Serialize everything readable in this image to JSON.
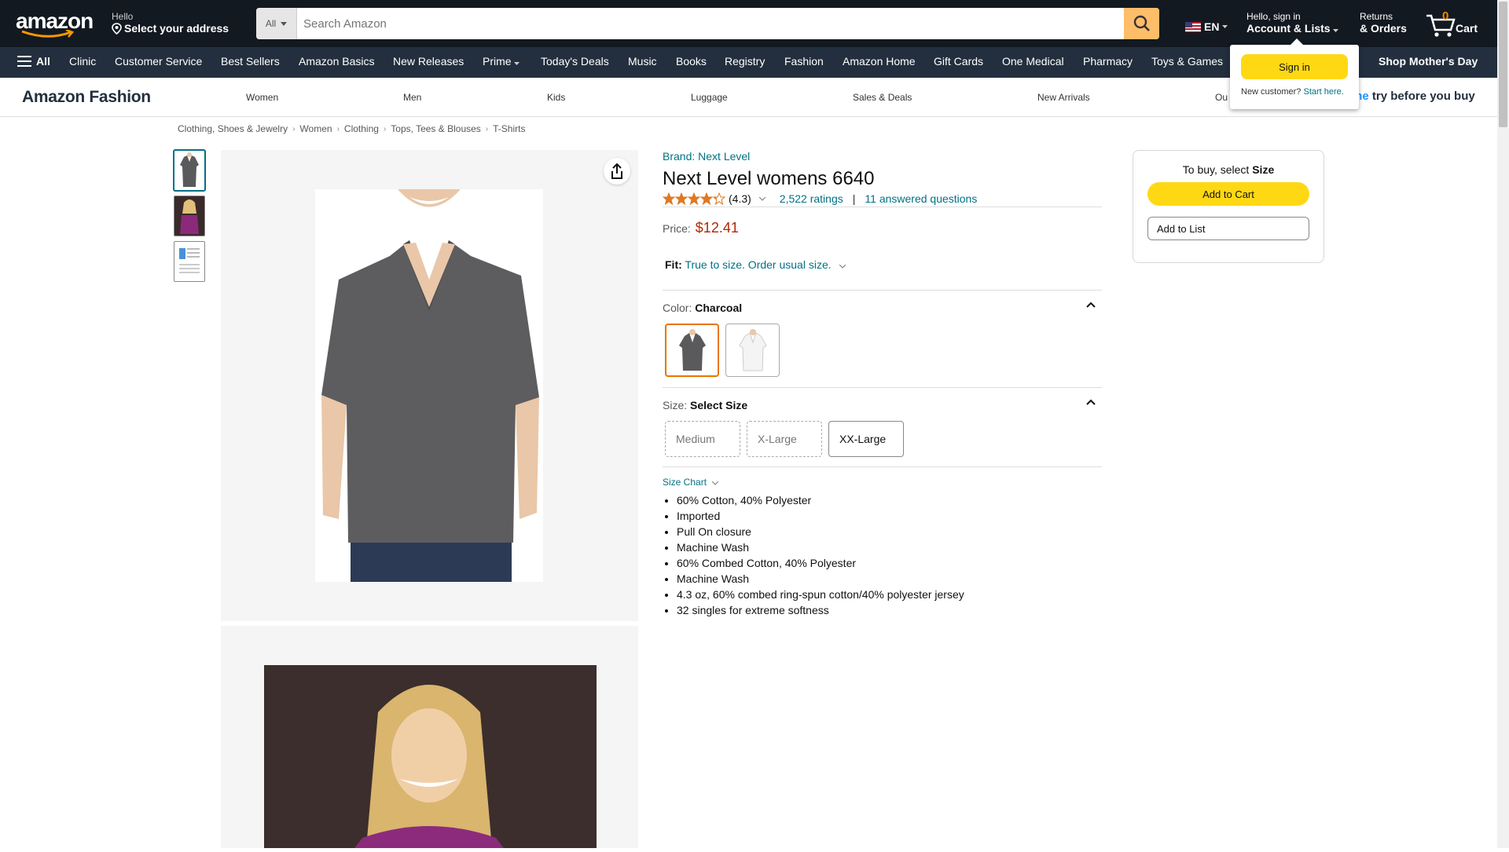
{
  "header": {
    "logo_text": "amazon",
    "address_line1": "Hello",
    "address_line2": "Select your address",
    "search_dept": "All",
    "search_placeholder": "Search Amazon",
    "language": "EN",
    "account_line1": "Hello, sign in",
    "account_line2": "Account & Lists",
    "returns_line1": "Returns",
    "returns_line2": "& Orders",
    "cart_count": "0",
    "cart_label": "Cart"
  },
  "subnav": {
    "all_label": "All",
    "items": [
      "Clinic",
      "Customer Service",
      "Best Sellers",
      "Amazon Basics",
      "New Releases",
      "Prime",
      "Today's Deals",
      "Music",
      "Books",
      "Registry",
      "Fashion",
      "Amazon Home",
      "Gift Cards",
      "One Medical",
      "Pharmacy",
      "Toys & Games"
    ],
    "promo": "Shop Mother's Day"
  },
  "fashion_nav": {
    "brand": "Amazon Fashion",
    "items": [
      "Women",
      "Men",
      "Kids",
      "Luggage",
      "Sales & Deals",
      "New Arrivals",
      "Ou"
    ],
    "try_prefix": "me",
    "try_text": "try before you buy"
  },
  "signin_popover": {
    "button": "Sign in",
    "new_customer": "New customer?",
    "start_here": "Start here."
  },
  "breadcrumb": [
    "Clothing, Shoes & Jewelry",
    "Women",
    "Clothing",
    "Tops, Tees & Blouses",
    "T-Shirts"
  ],
  "product": {
    "brand": "Brand: Next Level",
    "title": "Next Level womens 6640",
    "rating_value": "(4.3)",
    "rating_stars": 4.3,
    "ratings_count": "2,522 ratings",
    "separator": "|",
    "questions": "11 answered questions",
    "price_label": "Price:",
    "price": "$12.41",
    "fit_label": "Fit:",
    "fit_value": "True to size. Order usual size.",
    "color_label": "Color:",
    "color_value": "Charcoal",
    "size_label": "Size:",
    "size_value": "Select Size",
    "sizes": [
      "Medium",
      "X-Large",
      "XX-Large"
    ],
    "size_chart": "Size Chart",
    "bullets": [
      "60% Cotton, 40% Polyester",
      "Imported",
      "Pull On closure",
      "Machine Wash",
      "60% Combed Cotton, 40% Polyester",
      "Machine Wash",
      "4.3 oz, 60% combed ring-spun cotton/40% polyester jersey",
      "32 singles for extreme softness"
    ]
  },
  "buybox": {
    "prompt_prefix": "To buy, select",
    "prompt_bold": "Size",
    "add_to_cart": "Add to Cart",
    "add_to_list": "Add to List"
  },
  "colors": {
    "nav_bg": "#131921",
    "subnav_bg": "#232f3e",
    "accent_yellow": "#ffd814",
    "link": "#007185",
    "price": "#b12704",
    "selected_border": "#e77600"
  }
}
